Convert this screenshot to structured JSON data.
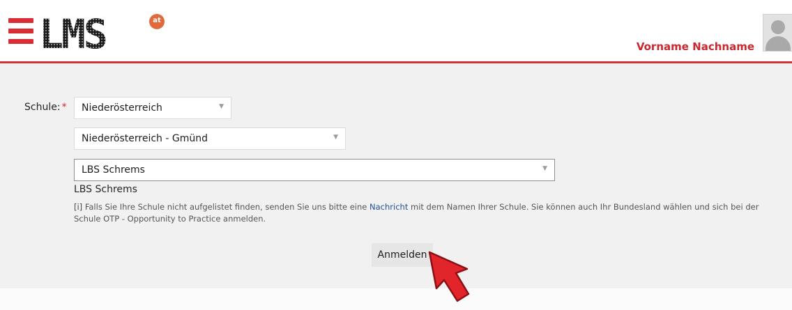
{
  "header": {
    "logo_text": "LMS",
    "logo_badge": "at",
    "user_name": "Vorname Nachname"
  },
  "form": {
    "school_label": "Schule:",
    "required_marker": "*",
    "state_select": {
      "value": "Niederösterreich"
    },
    "district_select": {
      "value": "Niederösterreich - Gmünd"
    },
    "school_select": {
      "value": "LBS Schrems"
    },
    "selected_school": "LBS Schrems",
    "info": {
      "marker": "[i]",
      "text_before": "Falls Sie Ihre Schule nicht aufgelistet finden, senden Sie uns bitte eine",
      "link": "Nachricht",
      "text_after": "mit dem Namen Ihrer Schule. Sie können auch Ihr Bundesland wählen und sich bei der Schule OTP - Opportunity to Practice anmelden."
    },
    "submit_label": "Anmelden"
  },
  "colors": {
    "brand_red": "#d82d34",
    "link_blue": "#1f4f9c",
    "cursor_red": "#e2242b"
  },
  "icons": [
    "hamburger-menu-icon",
    "user-avatar-icon",
    "chevron-down-icon",
    "mouse-pointer-icon"
  ]
}
